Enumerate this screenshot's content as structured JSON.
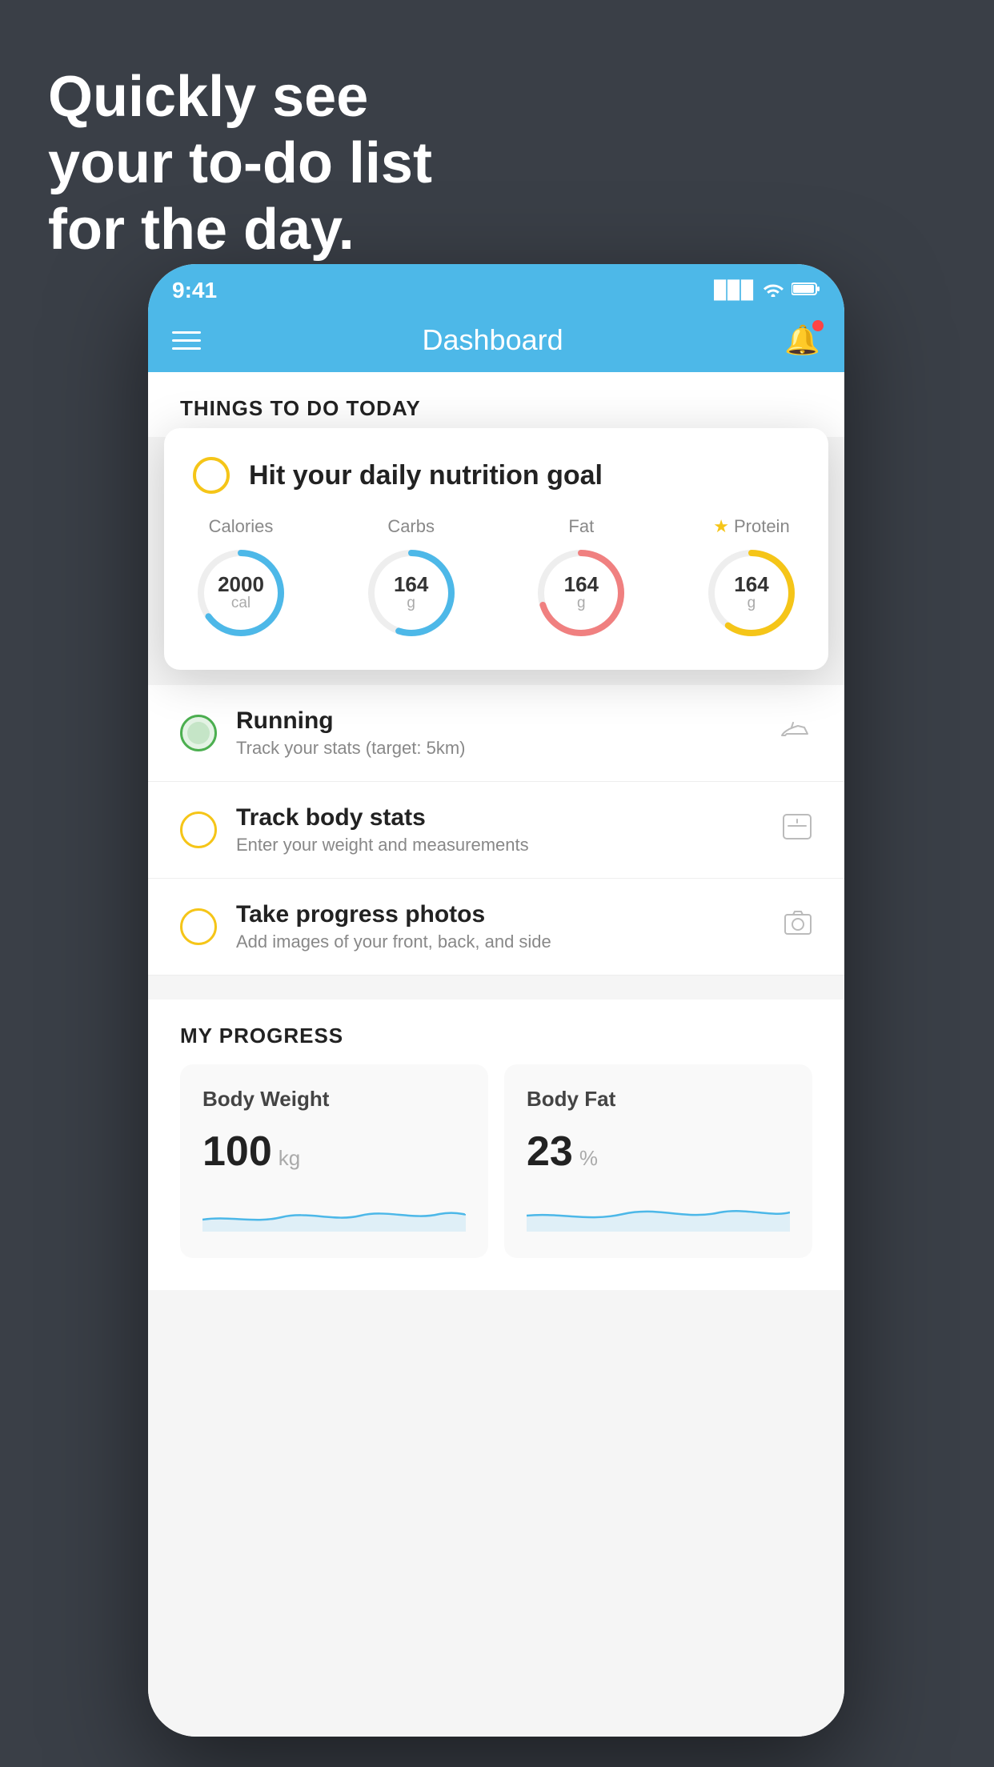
{
  "hero": {
    "line1": "Quickly see",
    "line2": "your to-do list",
    "line3": "for the day."
  },
  "phone": {
    "status_bar": {
      "time": "9:41",
      "signal": "▉▉▉",
      "wifi": "wifi",
      "battery": "battery"
    },
    "nav": {
      "title": "Dashboard"
    },
    "section_header": "THINGS TO DO TODAY",
    "floating_card": {
      "checkbox_label": "",
      "title": "Hit your daily nutrition goal",
      "calories": {
        "label": "Calories",
        "value": "2000",
        "unit": "cal",
        "percent": 65
      },
      "carbs": {
        "label": "Carbs",
        "value": "164",
        "unit": "g",
        "percent": 55
      },
      "fat": {
        "label": "Fat",
        "value": "164",
        "unit": "g",
        "percent": 70,
        "color": "pink"
      },
      "protein": {
        "label": "Protein",
        "value": "164",
        "unit": "g",
        "percent": 60,
        "color": "yellow",
        "starred": true
      }
    },
    "todo_items": [
      {
        "circle": "green",
        "title": "Running",
        "subtitle": "Track your stats (target: 5km)",
        "icon": "shoe"
      },
      {
        "circle": "yellow",
        "title": "Track body stats",
        "subtitle": "Enter your weight and measurements",
        "icon": "scale"
      },
      {
        "circle": "yellow",
        "title": "Take progress photos",
        "subtitle": "Add images of your front, back, and side",
        "icon": "photo"
      }
    ],
    "my_progress": {
      "header": "MY PROGRESS",
      "body_weight": {
        "label": "Body Weight",
        "value": "100",
        "unit": "kg"
      },
      "body_fat": {
        "label": "Body Fat",
        "value": "23",
        "unit": "%"
      }
    }
  }
}
